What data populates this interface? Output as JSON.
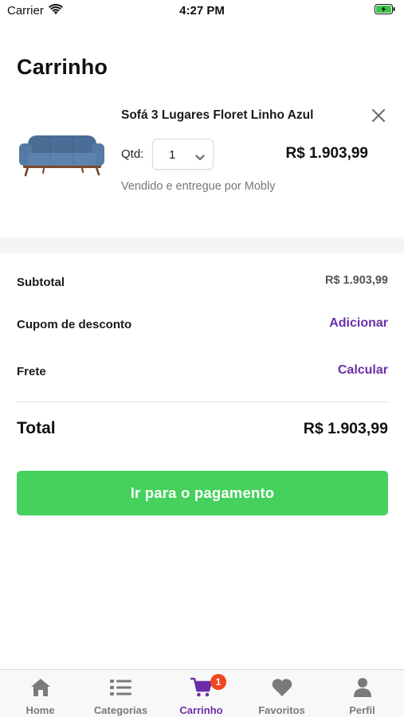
{
  "status_bar": {
    "carrier": "Carrier",
    "time": "4:27 PM"
  },
  "page": {
    "title": "Carrinho"
  },
  "cart_item": {
    "name": "Sofá 3 Lugares Floret Linho Azul",
    "qty_label": "Qtd:",
    "qty_value": "1",
    "price": "R$ 1.903,99",
    "seller": "Vendido e entregue por Mobly",
    "image_icon": "sofa-product-image"
  },
  "summary": {
    "subtotal_label": "Subtotal",
    "subtotal_value": "R$ 1.903,99",
    "coupon_label": "Cupom de desconto",
    "coupon_action": "Adicionar",
    "shipping_label": "Frete",
    "shipping_action": "Calcular",
    "total_label": "Total",
    "total_value": "R$ 1.903,99"
  },
  "checkout": {
    "button_label": "Ir para o pagamento"
  },
  "tab_bar": {
    "tabs": [
      {
        "label": "Home",
        "icon": "home-icon"
      },
      {
        "label": "Categorias",
        "icon": "list-icon"
      },
      {
        "label": "Carrinho",
        "icon": "cart-icon",
        "active": true,
        "badge": "1"
      },
      {
        "label": "Favoritos",
        "icon": "heart-icon"
      },
      {
        "label": "Perfil",
        "icon": "user-icon"
      }
    ]
  },
  "colors": {
    "accent": "#6b2ea8",
    "primary_button": "#45d15c",
    "badge": "#f2461f",
    "inactive_tab": "#7a7a7a"
  }
}
